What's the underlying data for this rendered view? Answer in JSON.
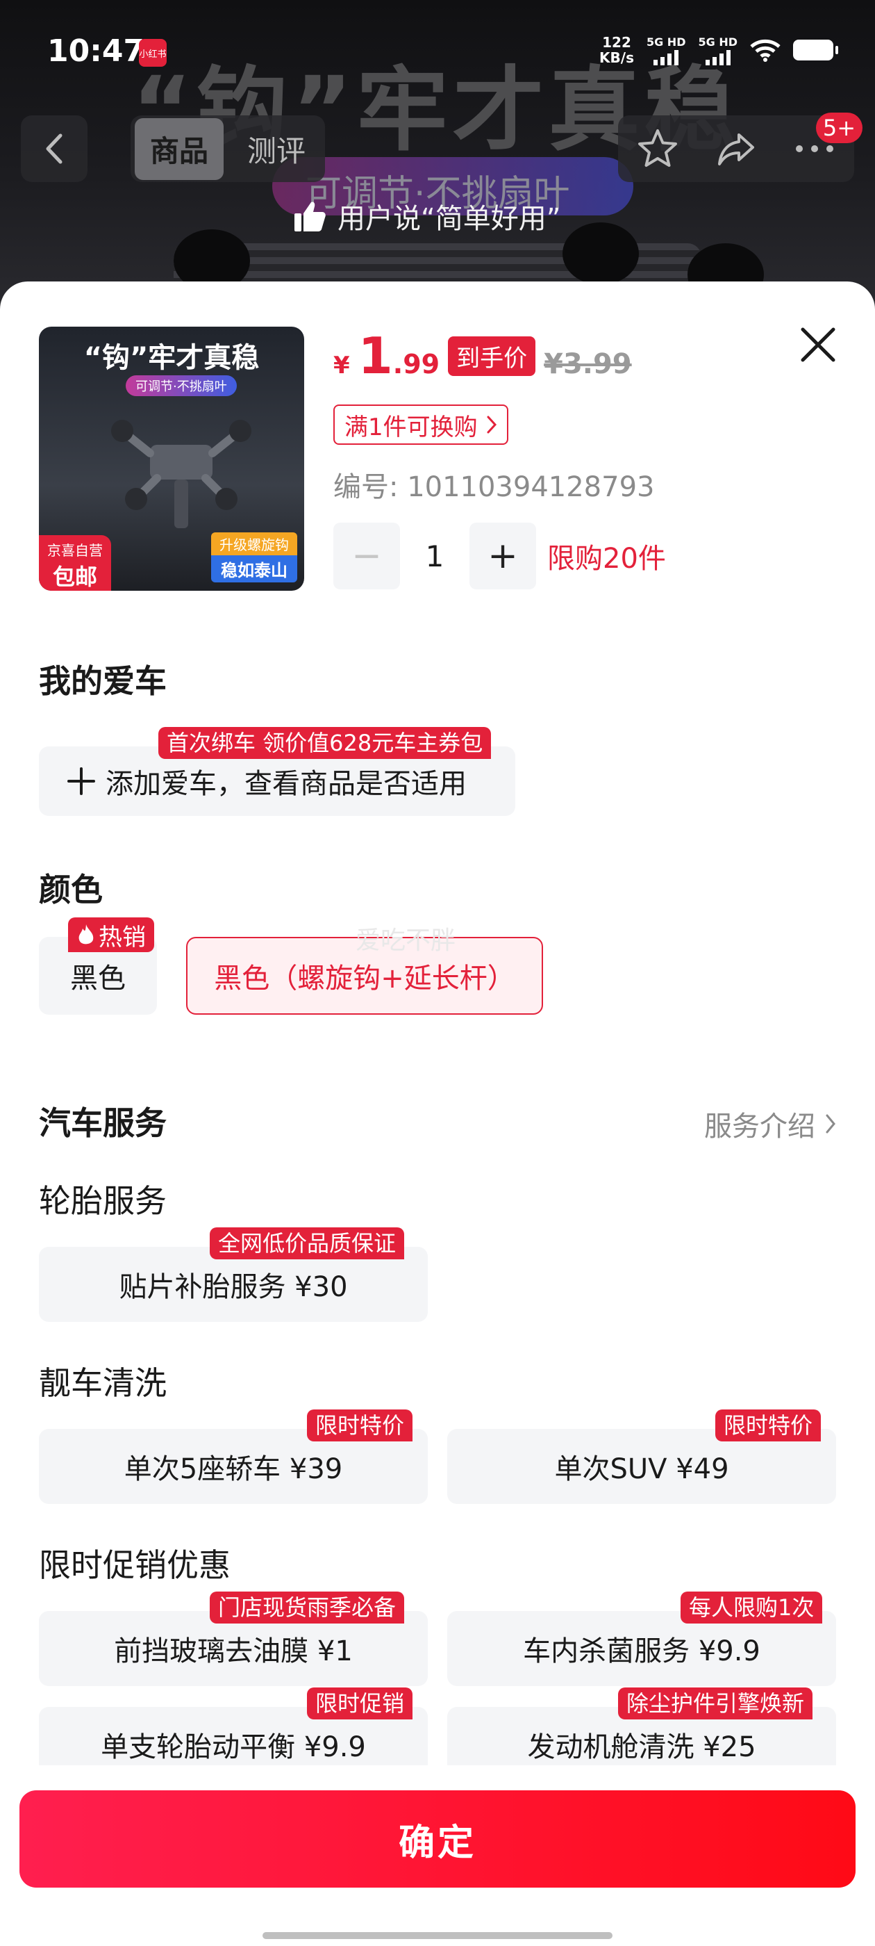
{
  "status_bar": {
    "time": "10:47",
    "app_badge": "小红书",
    "net_speed": "122",
    "net_unit": "KB/s",
    "sig1": "5G HD",
    "sig2": "5G HD"
  },
  "background": {
    "headline": "“钩”牢才真稳",
    "pill": "可调节·不挑扇叶",
    "review_tip": "用户说“简单好用”"
  },
  "nav": {
    "tabs": [
      "商品",
      "测评"
    ],
    "cart_badge": "5+"
  },
  "product": {
    "thumb_title": "“钩”牢才真稳",
    "thumb_sub": "可调节·不挑扇叶",
    "thumb_tag_left_a": "京喜自营",
    "thumb_tag_left_b": "包邮",
    "thumb_tag_right_a": "升级螺旋钩",
    "thumb_tag_right_b": "稳如泰山",
    "price_symbol": "¥",
    "price_int": "1",
    "price_dec": ".99",
    "price_tag": "到手价",
    "price_orig": "¥3.99",
    "swap": "满1件可换购",
    "sku": "编号: 10110394128793",
    "quantity": "1",
    "limit": "限购20件"
  },
  "my_car": {
    "title": "我的爱车",
    "ribbon": "首次绑车 领价值628元车主券包",
    "add": "添加爱车，查看商品是否适用"
  },
  "color": {
    "title": "颜色",
    "hot": "热销",
    "options": [
      "黑色",
      "黑色（螺旋钩+延长杆）"
    ],
    "watermark": "爱吃不胖"
  },
  "service": {
    "title": "汽车服务",
    "link": "服务介绍",
    "tire": {
      "title": "轮胎服务",
      "items": [
        {
          "label": "贴片补胎服务  ¥30",
          "ribbon": "全网低价品质保证"
        }
      ]
    },
    "wash": {
      "title": "靓车清洗",
      "items": [
        {
          "label": "单次5座轿车  ¥39",
          "ribbon": "限时特价"
        },
        {
          "label": "单次SUV  ¥49",
          "ribbon": "限时特价"
        }
      ]
    },
    "promo": {
      "title": "限时促销优惠",
      "items": [
        {
          "label": "前挡玻璃去油膜  ¥1",
          "ribbon": "门店现货雨季必备"
        },
        {
          "label": "车内杀菌服务  ¥9.9",
          "ribbon": "每人限购1次"
        },
        {
          "label": "单支轮胎动平衡  ¥9.9",
          "ribbon": "限时促销"
        },
        {
          "label": "发动机舱清洗  ¥25",
          "ribbon": "除尘护件引擎焕新"
        }
      ]
    }
  },
  "confirm": "确定",
  "colors": {
    "accent": "#e3213a",
    "confirm_start": "#ff1f4f",
    "confirm_end": "#ff0a16",
    "chip_bg": "#f4f5f7"
  }
}
